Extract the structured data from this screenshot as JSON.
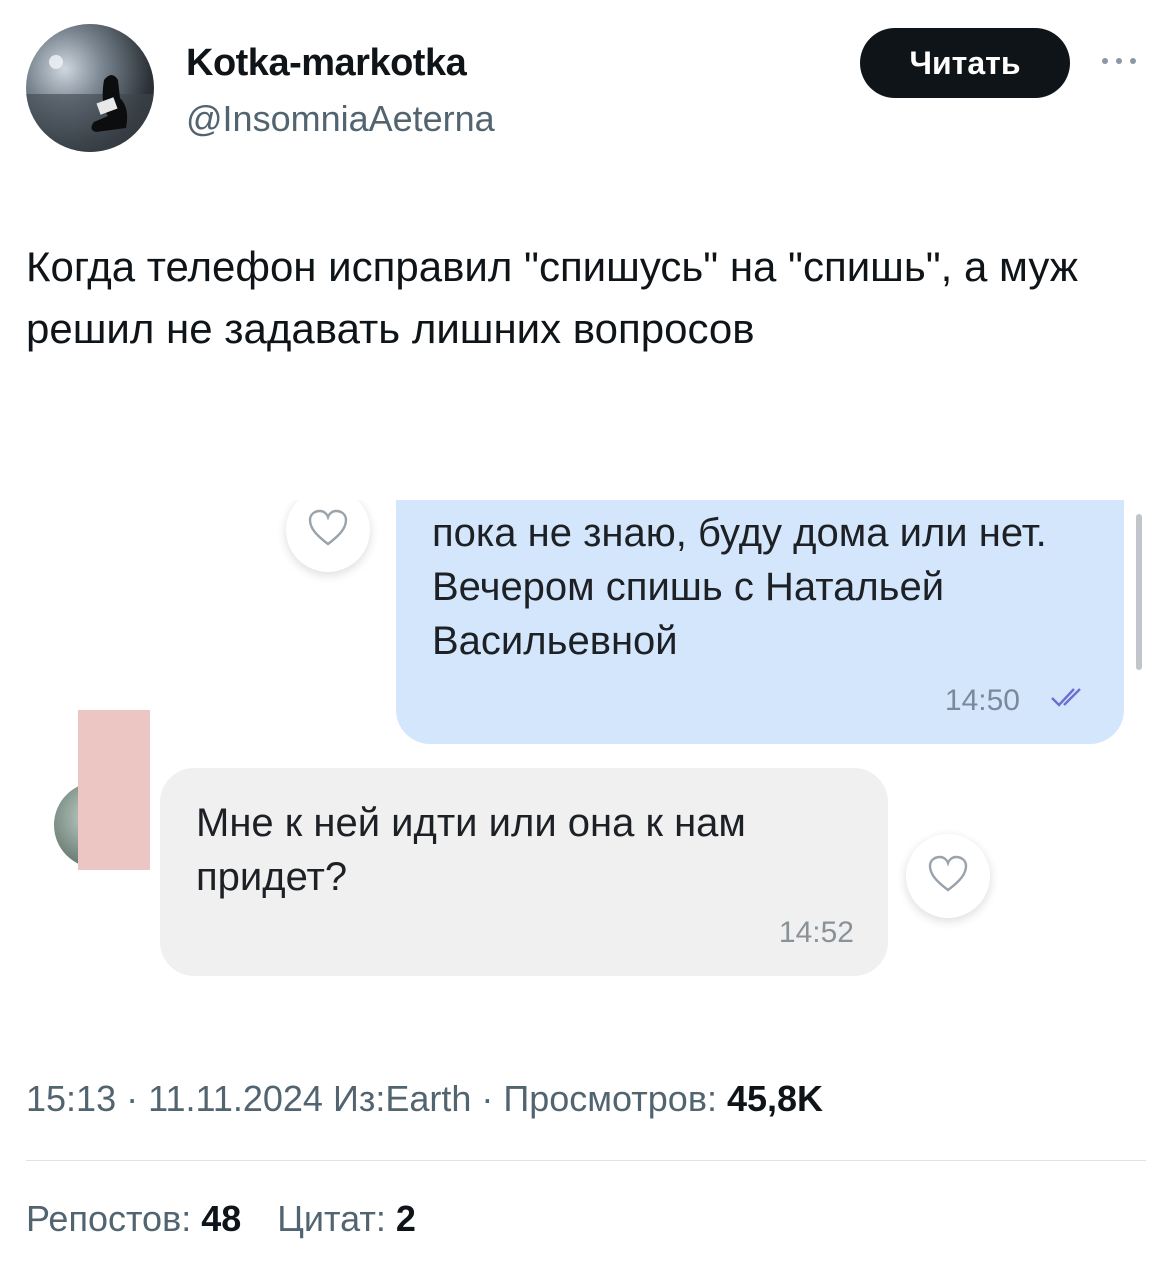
{
  "author": {
    "name": "Kotka-markotka",
    "handle": "@InsomniaAeterna"
  },
  "follow_button_label": "Читать",
  "more_icon": "more-dots-icon",
  "tweet_text": "Когда телефон исправил \"спишусь\" на \"спишь\", а муж решил не задавать лишних вопросов",
  "media": {
    "outgoing_message": {
      "text": "пока не знаю, буду дома или нет. Вечером спишь с Натальей Васильевной",
      "time": "14:50",
      "status_icon": "double-check-icon"
    },
    "incoming_message": {
      "text": "Мне к ней идти или она к нам придет?",
      "time": "14:52"
    },
    "reaction_icon": "heart-icon",
    "colors": {
      "outgoing_bubble": "#d4e6fb",
      "incoming_bubble": "#f0f0f0",
      "redaction": "#ebc6c3"
    }
  },
  "meta": {
    "time": "15:13",
    "date": "11.11.2024",
    "source": "Из:Earth",
    "views_label": "Просмотров:",
    "views_value": "45,8K"
  },
  "stats": {
    "reposts_label": "Репостов:",
    "reposts_value": "48",
    "quotes_label": "Цитат:",
    "quotes_value": "2"
  }
}
